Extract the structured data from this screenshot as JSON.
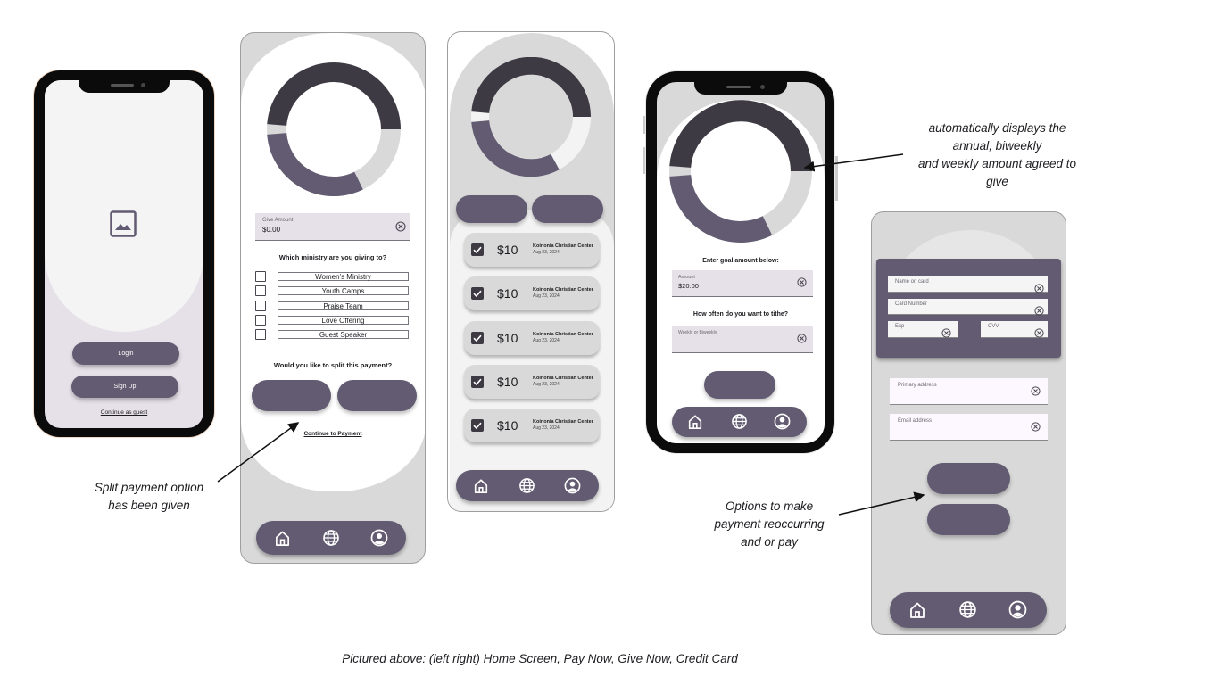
{
  "home": {
    "login_label": "Login",
    "signup_label": "Sign Up",
    "guest_link": "Continue as guest"
  },
  "pay_now": {
    "amount_label": "Give Amount",
    "amount_value": "$0.00",
    "ministry_question": "Which ministry are you giving to?",
    "ministries": [
      "Women's Ministry",
      "Youth Camps",
      "Praise Team",
      "Love Offering",
      "Guest Speaker"
    ],
    "split_question": "Would you like to split this payment?",
    "continue_link": "Continue to Payment"
  },
  "give_now": {
    "payments": [
      {
        "amount": "$10",
        "org": "Koinonia Christian Center",
        "date": "Aug 23, 2024",
        "checked": true
      },
      {
        "amount": "$10",
        "org": "Koinonia Christian Center",
        "date": "Aug 23, 2024",
        "checked": true
      },
      {
        "amount": "$10",
        "org": "Koinonia Christian Center",
        "date": "Aug 23, 2024",
        "checked": true
      },
      {
        "amount": "$10",
        "org": "Koinonia Christian Center",
        "date": "Aug 23, 2024",
        "checked": true
      },
      {
        "amount": "$10",
        "org": "Koinonia Christian Center",
        "date": "Aug 23, 2024",
        "checked": true
      }
    ]
  },
  "goal": {
    "prompt": "Enter goal amount below:",
    "amount_label": "Amount",
    "amount_value": "$20.00",
    "frequency_question": "How often do you want to tithe?",
    "frequency_placeholder": "Weekly or Biweekly"
  },
  "credit_card": {
    "name_placeholder": "Name on card",
    "number_placeholder": "Card Number",
    "exp_placeholder": "Exp",
    "cvv_placeholder": "CVV",
    "primary_address_placeholder": "Primary address",
    "email_placeholder": "Email address"
  },
  "annotations": {
    "split_note_line1": "Split payment option",
    "split_note_line2": "has been given",
    "goal_note_line1": "automatically displays the",
    "goal_note_line2": "annual, biweekly",
    "goal_note_line3": "and weekly amount agreed to",
    "goal_note_line4": "give",
    "options_note_line1": "Options to make",
    "options_note_line2": "payment reoccurring",
    "options_note_line3": "and or pay"
  },
  "caption": "Pictured above: (left right) Home Screen, Pay Now, Give Now, Credit Card",
  "colors": {
    "primary": "#625b71",
    "dark": "#3d3a44",
    "surface": "#d9d9d9"
  },
  "icons": [
    "image-icon",
    "clear-icon",
    "checkbox-icon",
    "home-icon",
    "globe-icon",
    "account-icon"
  ]
}
